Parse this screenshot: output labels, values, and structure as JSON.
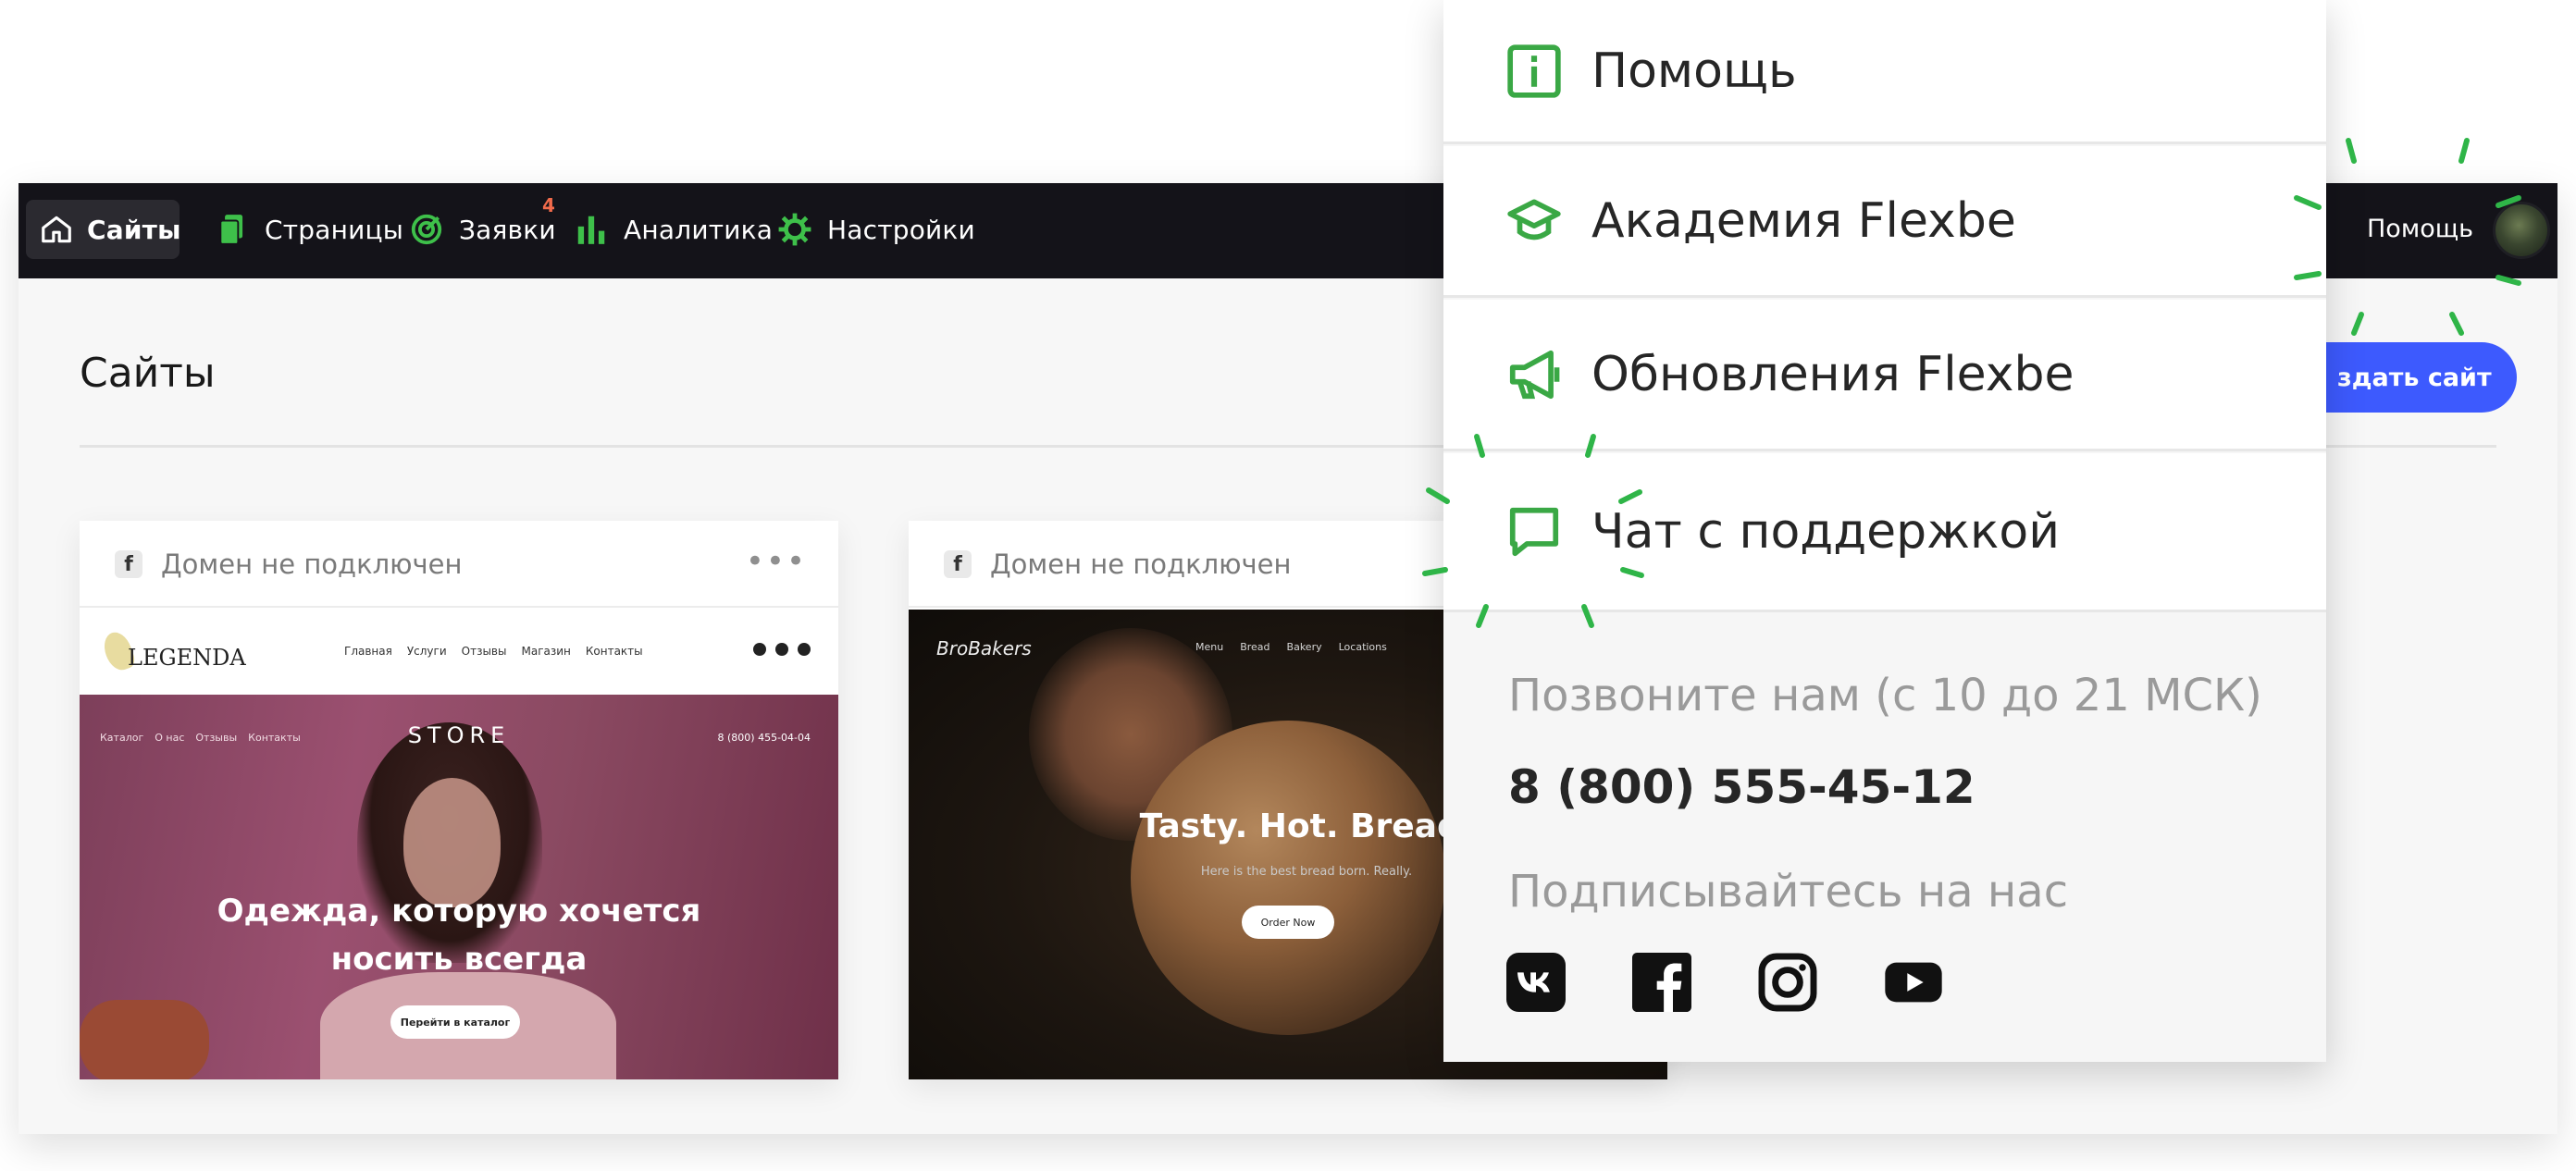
{
  "nav": {
    "items": [
      {
        "label": "Сайты",
        "icon": "home-icon"
      },
      {
        "label": "Страницы",
        "icon": "pages-icon"
      },
      {
        "label": "Заявки",
        "icon": "target-icon",
        "badge": "4"
      },
      {
        "label": "Аналитика",
        "icon": "analytics-icon"
      },
      {
        "label": "Настройки",
        "icon": "gear-icon"
      }
    ],
    "help_label": "Помощь",
    "accent": "#3ec04a",
    "badge_color": "#f26b4b"
  },
  "main": {
    "title": "Сайты",
    "create_button_label": "здать сайт",
    "create_button_color": "#3d5afe"
  },
  "cards": [
    {
      "domain_text": "Домен не подключен",
      "preview": {
        "logo": "LEGENDA",
        "nav": [
          "Главная",
          "Услуги",
          "Отзывы",
          "Магазин",
          "Контакты"
        ],
        "sub_nav": [
          "Каталог",
          "О нас",
          "Отзывы",
          "Контакты"
        ],
        "store_label": "STORE",
        "phone": "8 (800) 455-04-04",
        "headline_line1": "Одежда, которую хочется",
        "headline_line2": "носить всегда",
        "button": "Перейти в каталог"
      }
    },
    {
      "domain_text": "Домен не подключен",
      "preview": {
        "logo": "BroBakers",
        "nav": [
          "Menu",
          "Bread",
          "Bakery",
          "Locations"
        ],
        "headline": "Tasty. Hot. Bread.",
        "subline": "Here is the best bread born. Really.",
        "button": "Order Now"
      }
    }
  ],
  "dropdown": {
    "items": [
      {
        "label": "Помощь",
        "icon": "info-icon"
      },
      {
        "label": "Академия Flexbe",
        "icon": "graduation-cap-icon"
      },
      {
        "label": "Обновления Flexbe",
        "icon": "megaphone-icon"
      },
      {
        "label": "Чат с поддержкой",
        "icon": "chat-bubble-icon"
      }
    ],
    "call_label": "Позвоните нам (с 10 до 21 МСК)",
    "phone": "8 (800) 555-45-12",
    "subscribe_label": "Подписывайтесь на нас",
    "socials": [
      "vk-icon",
      "facebook-icon",
      "instagram-icon",
      "youtube-icon"
    ],
    "icon_color": "#3aa845"
  }
}
